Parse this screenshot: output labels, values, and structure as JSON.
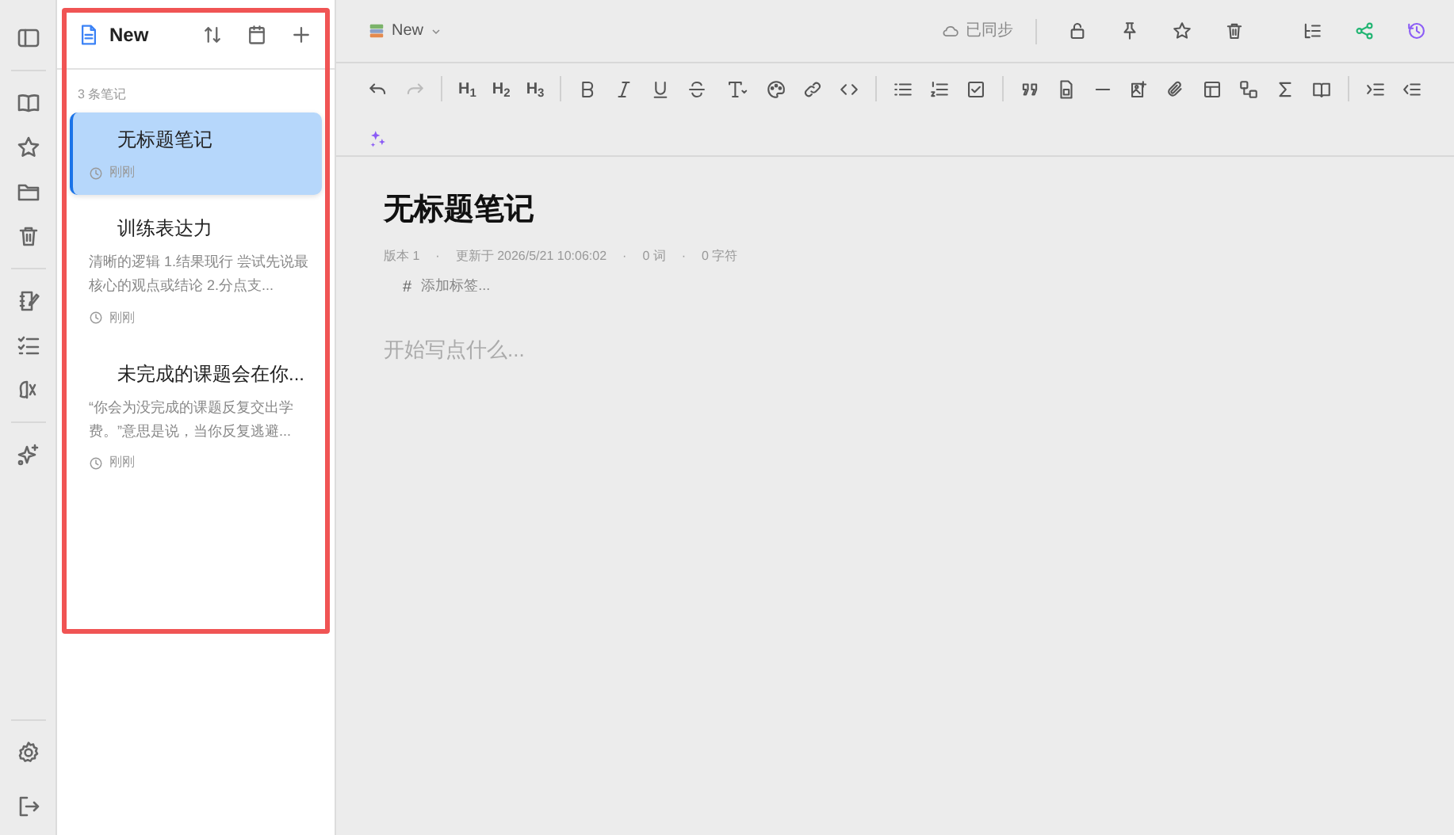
{
  "notes_panel": {
    "title": "New",
    "count": "3 条笔记",
    "notes": [
      {
        "title": "无标题笔记",
        "time": "刚刚",
        "selected": true
      },
      {
        "title": "训练表达力",
        "preview": "清晰的逻辑 1.结果现行 尝试先说最核心的观点或结论 2.分点支...",
        "time": "刚刚",
        "selected": false
      },
      {
        "title": "未完成的课题会在你...",
        "preview": "“你会为没完成的课题反复交出学费。”意思是说，当你反复逃避...",
        "time": "刚刚",
        "selected": false
      }
    ]
  },
  "top_bar": {
    "notebook": "New",
    "sync": "已同步"
  },
  "toolbar": {
    "headings": [
      "H$_{1}$",
      "H$_{2}$",
      "H$_{3}$"
    ],
    "redo_disabled": true
  },
  "editor": {
    "title": "无标题笔记",
    "meta": [
      "版本 1",
      "更新于 2026/5/21 10:06:02",
      "0 词",
      "0 字符"
    ],
    "meta_separator": "·",
    "tag_mark": "#",
    "tag_placeholder": "添加标签...",
    "body_placeholder": "开始写点什么..."
  },
  "highlight": {
    "color": "#f05454"
  }
}
